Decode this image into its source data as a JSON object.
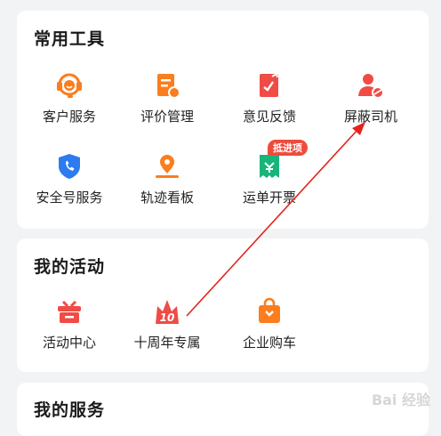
{
  "sections": {
    "common_tools": {
      "title": "常用工具",
      "items": [
        {
          "label": "客户服务",
          "icon": "headset-icon"
        },
        {
          "label": "评价管理",
          "icon": "review-doc-icon"
        },
        {
          "label": "意见反馈",
          "icon": "feedback-icon"
        },
        {
          "label": "屏蔽司机",
          "icon": "block-driver-icon"
        },
        {
          "label": "安全号服务",
          "icon": "shield-phone-icon"
        },
        {
          "label": "轨迹看板",
          "icon": "track-pin-icon"
        },
        {
          "label": "运单开票",
          "icon": "invoice-icon",
          "badge": "抵进项"
        }
      ]
    },
    "my_activities": {
      "title": "我的活动",
      "items": [
        {
          "label": "活动中心",
          "icon": "gift-icon"
        },
        {
          "label": "十周年专属",
          "icon": "anniversary-10-icon"
        },
        {
          "label": "企业购车",
          "icon": "shopping-bag-icon"
        }
      ]
    },
    "my_services": {
      "title": "我的服务"
    }
  },
  "watermark": "Bai 经验",
  "colors": {
    "orange": "#fb7d1e",
    "red": "#f04b45",
    "blue": "#2e7bf0",
    "green": "#19b47a",
    "badge": "#ec4c3c",
    "arrow": "#e3231c"
  }
}
